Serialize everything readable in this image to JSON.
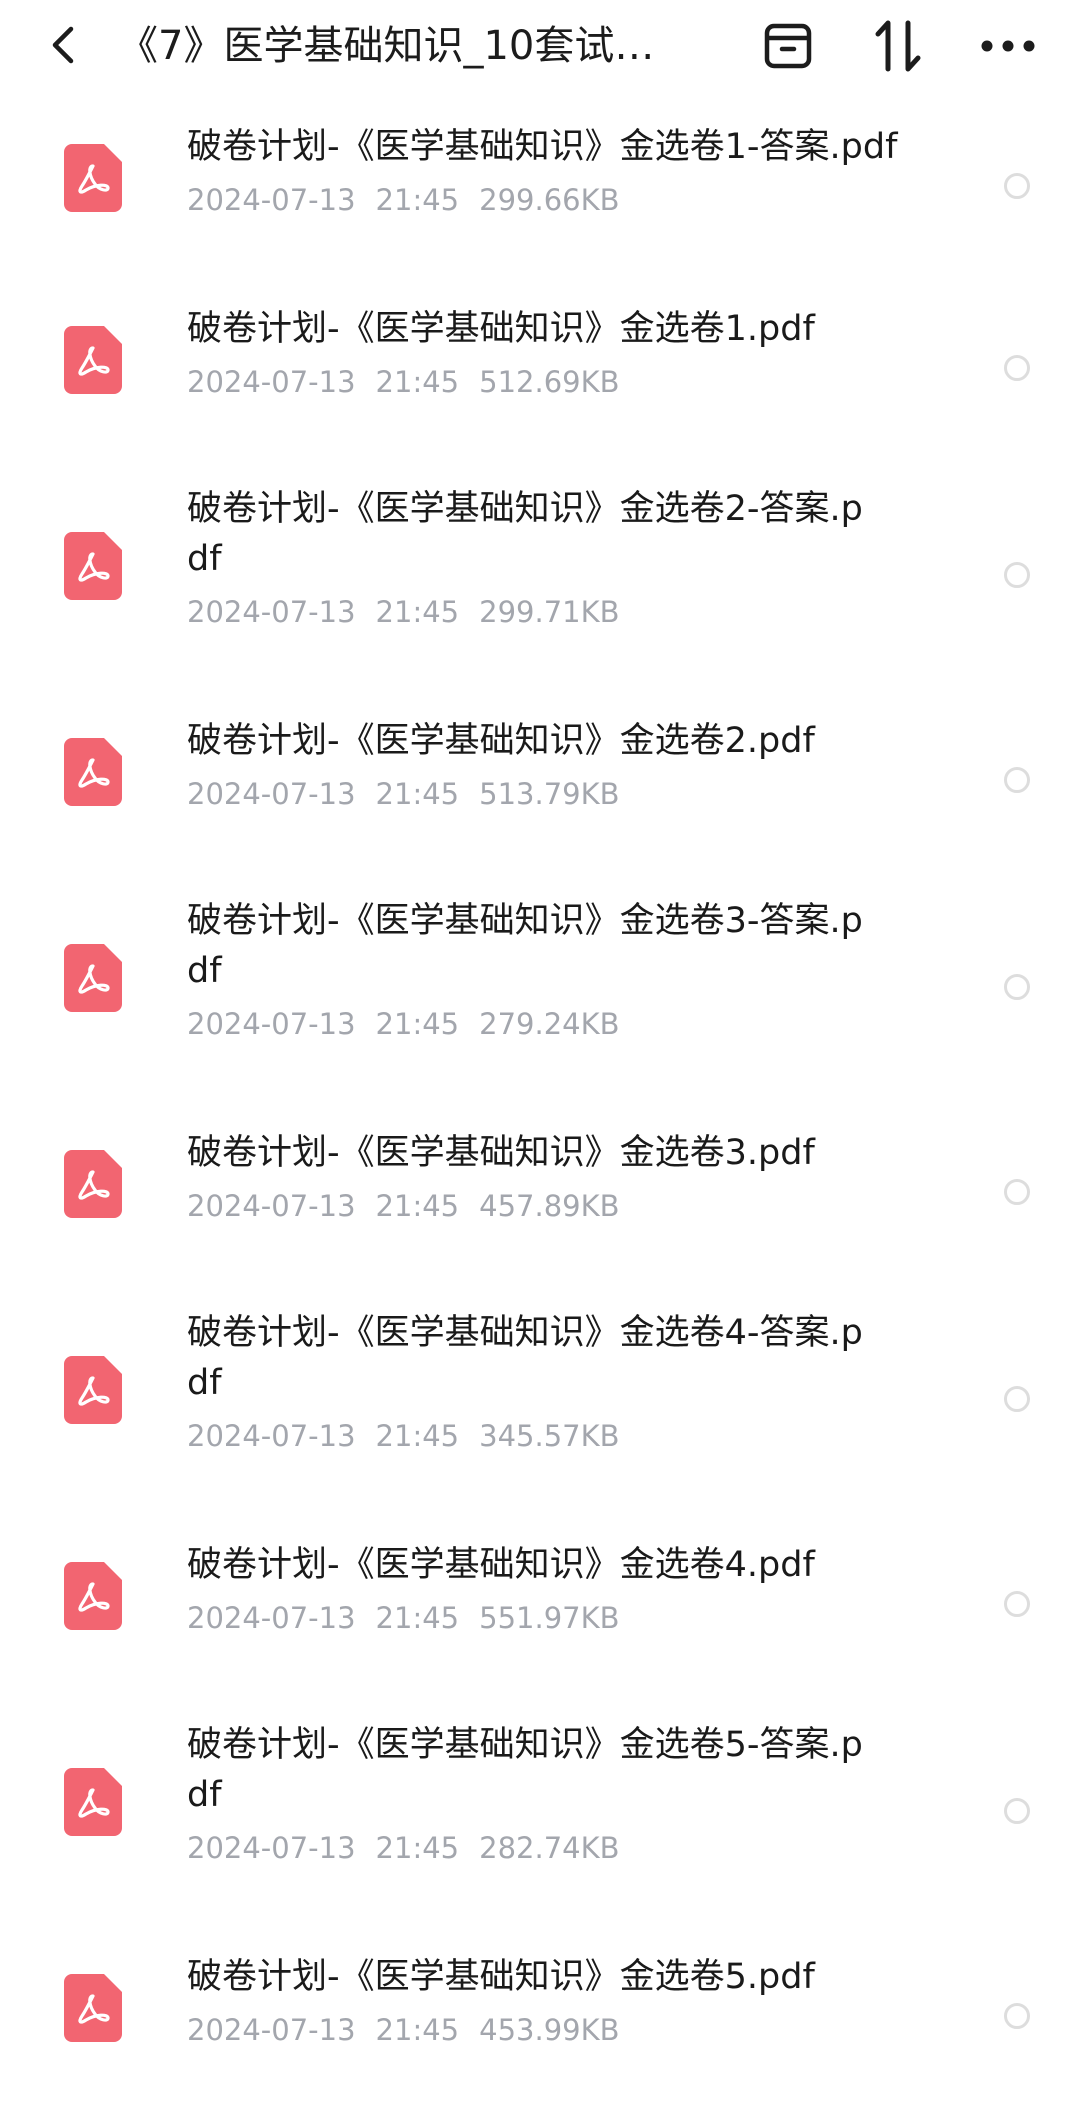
{
  "header": {
    "title": "《7》医学基础知识_10套试…",
    "back_icon": "chevron-left-icon",
    "archive_icon": "archive-box-icon",
    "sort_icon": "sort-arrows-icon",
    "more_icon": "more-dots-icon"
  },
  "colors": {
    "pdf_icon": "#f26571",
    "meta_text": "#a3a6ad",
    "radio_border": "#dddddd"
  },
  "files": [
    {
      "name": "破卷计划-《医学基础知识》金选卷1-答案.pdf",
      "date": "2024-07-13",
      "time": "21:45",
      "size": "299.66KB"
    },
    {
      "name": "破卷计划-《医学基础知识》金选卷1.pdf",
      "date": "2024-07-13",
      "time": "21:45",
      "size": "512.69KB"
    },
    {
      "name": "破卷计划-《医学基础知识》金选卷2-答案.pdf",
      "date": "2024-07-13",
      "time": "21:45",
      "size": "299.71KB"
    },
    {
      "name": "破卷计划-《医学基础知识》金选卷2.pdf",
      "date": "2024-07-13",
      "time": "21:45",
      "size": "513.79KB"
    },
    {
      "name": "破卷计划-《医学基础知识》金选卷3-答案.pdf",
      "date": "2024-07-13",
      "time": "21:45",
      "size": "279.24KB"
    },
    {
      "name": "破卷计划-《医学基础知识》金选卷3.pdf",
      "date": "2024-07-13",
      "time": "21:45",
      "size": "457.89KB"
    },
    {
      "name": "破卷计划-《医学基础知识》金选卷4-答案.pdf",
      "date": "2024-07-13",
      "time": "21:45",
      "size": "345.57KB"
    },
    {
      "name": "破卷计划-《医学基础知识》金选卷4.pdf",
      "date": "2024-07-13",
      "time": "21:45",
      "size": "551.97KB"
    },
    {
      "name": "破卷计划-《医学基础知识》金选卷5-答案.pdf",
      "date": "2024-07-13",
      "time": "21:45",
      "size": "282.74KB"
    },
    {
      "name": "破卷计划-《医学基础知识》金选卷5.pdf",
      "date": "2024-07-13",
      "time": "21:45",
      "size": "453.99KB"
    }
  ]
}
